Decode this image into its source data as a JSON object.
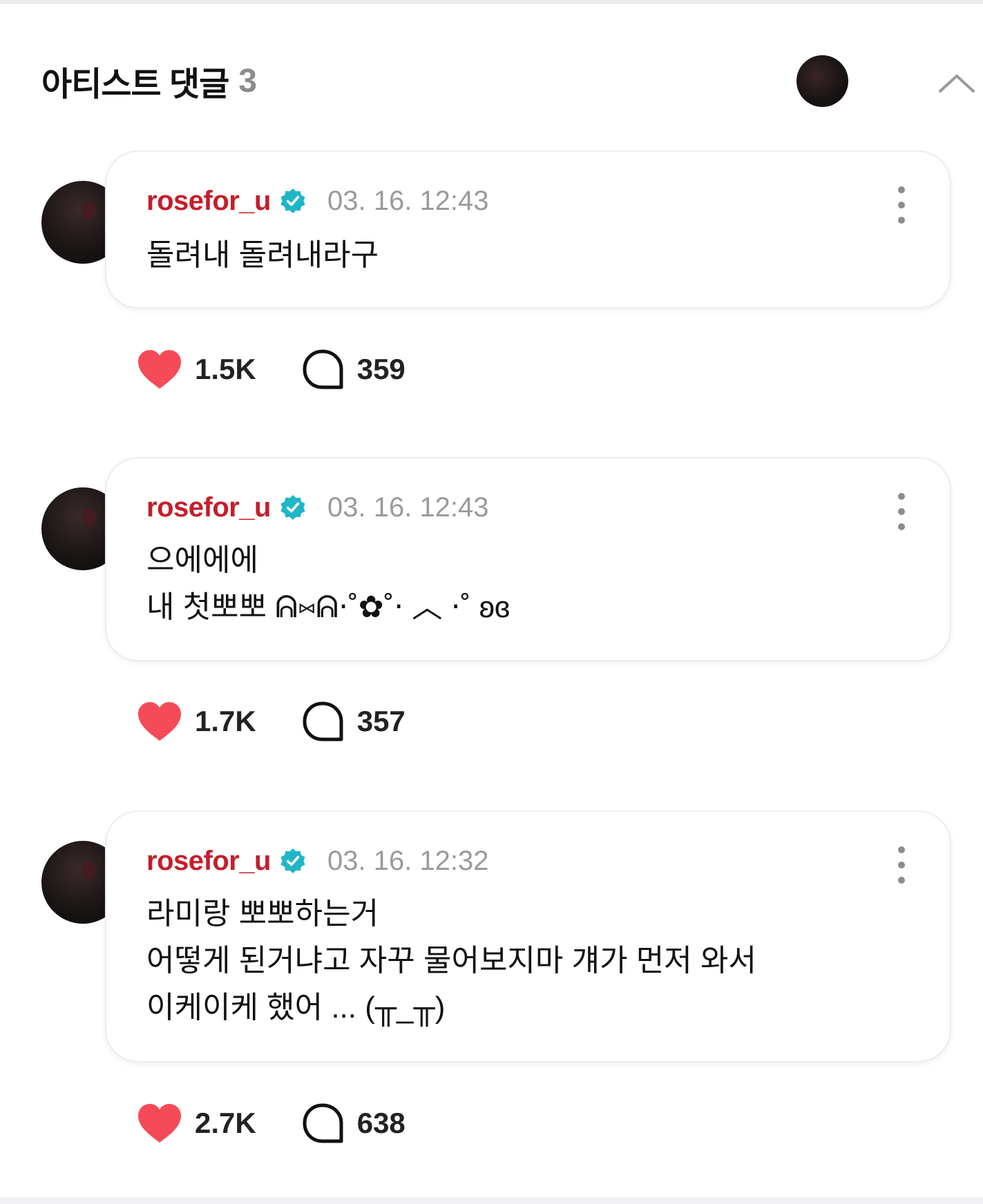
{
  "header": {
    "title": "아티스트 댓글",
    "count": "3"
  },
  "colors": {
    "username": "#c41e2a",
    "verified": "#1fb6c8",
    "heart": "#f54b58",
    "timestamp": "#9a9a9a"
  },
  "comments": [
    {
      "username": "rosefor_u",
      "timestamp": "03. 16. 12:43",
      "lines": [
        "돌려내 돌려내라구"
      ],
      "likes": "1.5K",
      "replies": "359"
    },
    {
      "username": "rosefor_u",
      "timestamp": "03. 16. 12:43",
      "lines": [
        "으에에에",
        "내 첫뽀뽀 ᕱ⑅︎ᕱ‧˚✿˚‧ ︿ ‧˚ ʚɞ"
      ],
      "likes": "1.7K",
      "replies": "357"
    },
    {
      "username": "rosefor_u",
      "timestamp": "03. 16. 12:32",
      "lines": [
        "라미랑 뽀뽀하는거",
        "어떻게 된거냐고 자꾸 물어보지마 걔가 먼저 와서",
        "이케이케 했어 ... (╥_╥)"
      ],
      "likes": "2.7K",
      "replies": "638"
    }
  ]
}
